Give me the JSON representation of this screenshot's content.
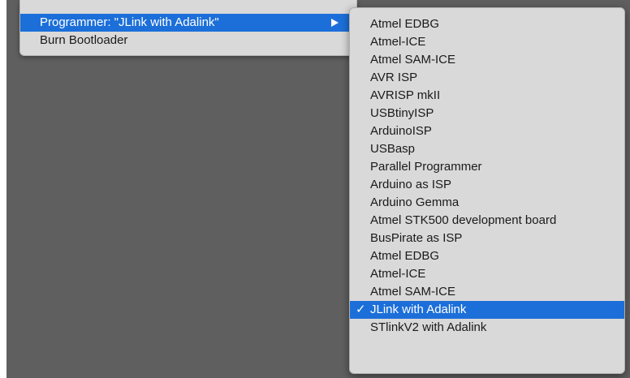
{
  "colors": {
    "highlight": "#1c6fd9",
    "menu_background": "#d9d9d9",
    "backdrop": "#5f5f5f"
  },
  "main_menu": {
    "items": [
      {
        "label": "Programmer: \"JLink with Adalink\"",
        "highlighted": true,
        "has_submenu": true,
        "submenu_icon": "arrow-right-icon"
      },
      {
        "label": "Burn Bootloader",
        "highlighted": false,
        "has_submenu": false
      }
    ]
  },
  "programmer_submenu": {
    "checkmark": "✓",
    "selected_index": 17,
    "items": [
      "Atmel EDBG",
      "Atmel-ICE",
      "Atmel SAM-ICE",
      "AVR ISP",
      "AVRISP mkII",
      "USBtinyISP",
      "ArduinoISP",
      "USBasp",
      "Parallel Programmer",
      "Arduino as ISP",
      "Arduino Gemma",
      "Atmel STK500 development board",
      "BusPirate as ISP",
      "Atmel EDBG",
      "Atmel-ICE",
      "Atmel SAM-ICE",
      "JLink with Adalink",
      "STlinkV2 with Adalink"
    ]
  }
}
